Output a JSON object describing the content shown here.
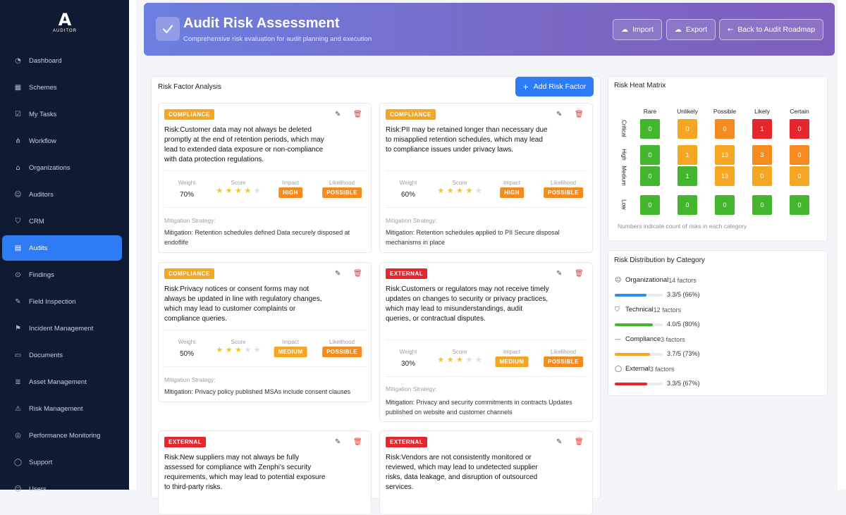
{
  "brand": {
    "mark": "A",
    "name": "AUDITOR"
  },
  "nav": [
    {
      "label": "Dashboard",
      "icon": "dashboard-icon",
      "glyph": "◔"
    },
    {
      "label": "Schemes",
      "icon": "grid-icon",
      "glyph": "▦"
    },
    {
      "label": "My Tasks",
      "icon": "checkbox-icon",
      "glyph": "☑"
    },
    {
      "label": "Workflow",
      "icon": "workflow-icon",
      "glyph": "⋔"
    },
    {
      "label": "Organizations",
      "icon": "bank-icon",
      "glyph": "⌂"
    },
    {
      "label": "Auditors",
      "icon": "users-icon",
      "glyph": "☺"
    },
    {
      "label": "CRM",
      "icon": "shield-icon",
      "glyph": "⛉"
    },
    {
      "label": "Audits",
      "icon": "clipboard-icon",
      "glyph": "▤",
      "active": true
    },
    {
      "label": "Findings",
      "icon": "search-icon",
      "glyph": "⊙"
    },
    {
      "label": "Field Inspection",
      "icon": "edit-icon",
      "glyph": "✎"
    },
    {
      "label": "Incident Management",
      "icon": "incident-icon",
      "glyph": "⚑"
    },
    {
      "label": "Documents",
      "icon": "document-icon",
      "glyph": "▭"
    },
    {
      "label": "Asset Management",
      "icon": "database-icon",
      "glyph": "≣"
    },
    {
      "label": "Risk Management",
      "icon": "warning-icon",
      "glyph": "⚠"
    },
    {
      "label": "Performance Monitoring",
      "icon": "monitor-icon",
      "glyph": "◎"
    },
    {
      "label": "Support",
      "icon": "support-icon",
      "glyph": "◯"
    },
    {
      "label": "Users",
      "icon": "user-icon",
      "glyph": "☺"
    }
  ],
  "header": {
    "title": "Audit Risk Assessment",
    "subtitle": "Comprehensive risk evaluation for audit planning and execution",
    "import_label": "Import",
    "export_label": "Export",
    "back_label": "Back to Audit Roadmap"
  },
  "analysis": {
    "title": "Risk Factor Analysis",
    "add_label": "Add Risk Factor",
    "metric_labels": {
      "weight": "Weight",
      "score": "Score",
      "impact": "Impact",
      "likelihood": "Likelihood"
    },
    "mitigation_label": "Mitigation Strategy:",
    "cards": [
      {
        "category": "COMPLIANCE",
        "category_color": "#f5a623",
        "risk": "Risk:Customer data may not always be deleted promptly at the end of retention periods, which may lead to extended data exposure or non-compliance with data protection regulations.",
        "weight": "70%",
        "stars": 4,
        "impact": "HIGH",
        "impact_color": "#f58a1f",
        "likelihood": "POSSIBLE",
        "likelihood_color": "#f58a1f",
        "mitigation": "Mitigation: Retention schedules defined Data securely disposed at endoflife"
      },
      {
        "category": "COMPLIANCE",
        "category_color": "#f5a623",
        "risk": "Risk:PII may be retained longer than necessary due to misapplied retention schedules, which may lead to compliance issues under privacy laws.",
        "weight": "60%",
        "stars": 4,
        "impact": "HIGH",
        "impact_color": "#f58a1f",
        "likelihood": "POSSIBLE",
        "likelihood_color": "#f58a1f",
        "mitigation": "Mitigation: Retention schedules applied to PII Secure disposal mechanisms in place"
      },
      {
        "category": "COMPLIANCE",
        "category_color": "#f5a623",
        "risk": "Risk:Privacy notices or consent forms may not always be updated in line with regulatory changes, which may lead to customer complaints or compliance queries.",
        "weight": "50%",
        "stars": 3,
        "impact": "MEDIUM",
        "impact_color": "#f5a623",
        "likelihood": "POSSIBLE",
        "likelihood_color": "#f58a1f",
        "mitigation": "Mitigation: Privacy policy published MSAs include consent clauses"
      },
      {
        "category": "EXTERNAL",
        "category_color": "#e5262c",
        "risk": "Risk:Customers or regulators may not receive timely updates on changes to security or privacy practices, which may lead to misunderstandings, audit queries, or contractual disputes.",
        "weight": "30%",
        "stars": 3,
        "impact": "MEDIUM",
        "impact_color": "#f5a623",
        "likelihood": "POSSIBLE",
        "likelihood_color": "#f58a1f",
        "mitigation": "Mitigation: Privacy and security commitments in contracts Updates published on website and customer channels"
      },
      {
        "category": "EXTERNAL",
        "category_color": "#e5262c",
        "risk": "Risk:New suppliers may not always be fully assessed for compliance with Zenphi's security requirements, which may lead to potential exposure to third-party risks."
      },
      {
        "category": "EXTERNAL",
        "category_color": "#e5262c",
        "risk": "Risk:Vendors are not consistently monitored or reviewed, which may lead to undetected supplier risks, data leakage, and disruption of outsourced services."
      }
    ]
  },
  "heatmap": {
    "title": "Risk Heat Matrix",
    "columns": [
      "Rare",
      "Unlikely",
      "Possible",
      "Likely",
      "Certain"
    ],
    "rows": [
      {
        "label": "Critical",
        "cells": [
          {
            "v": "0",
            "c": "#43b62e"
          },
          {
            "v": "0",
            "c": "#f5a623"
          },
          {
            "v": "0",
            "c": "#f58a1f"
          },
          {
            "v": "1",
            "c": "#e5262c"
          },
          {
            "v": "0",
            "c": "#e5262c"
          }
        ]
      },
      {
        "label": "High",
        "cells": [
          {
            "v": "0",
            "c": "#43b62e"
          },
          {
            "v": "1",
            "c": "#f5a623"
          },
          {
            "v": "13",
            "c": "#f5a623"
          },
          {
            "v": "3",
            "c": "#f58a1f"
          },
          {
            "v": "0",
            "c": "#f58a1f"
          }
        ]
      },
      {
        "label": "Medium",
        "cells": [
          {
            "v": "0",
            "c": "#43b62e"
          },
          {
            "v": "1",
            "c": "#43b62e"
          },
          {
            "v": "13",
            "c": "#f5a623"
          },
          {
            "v": "0",
            "c": "#f5a623"
          },
          {
            "v": "0",
            "c": "#f5a623"
          }
        ]
      },
      {
        "label": "Low",
        "cells": [
          {
            "v": "0",
            "c": "#43b62e"
          },
          {
            "v": "0",
            "c": "#43b62e"
          },
          {
            "v": "0",
            "c": "#43b62e"
          },
          {
            "v": "0",
            "c": "#43b62e"
          },
          {
            "v": "0",
            "c": "#43b62e"
          }
        ]
      }
    ],
    "note": "Numbers indicate count of risks in each category"
  },
  "distribution": {
    "title": "Risk Distribution by Category",
    "items": [
      {
        "name": "Organizational",
        "count": "14 factors",
        "icon": "users-icon",
        "glyph": "☺",
        "score": "3.3/5 (66%)",
        "fraction": 0.66,
        "color": "#2d8ef0"
      },
      {
        "name": "Technical",
        "count": "12 factors",
        "icon": "shield-icon",
        "glyph": "⛉",
        "score": "4.0/5 (80%)",
        "fraction": 0.8,
        "color": "#43b62e"
      },
      {
        "name": "Compliance",
        "count": "3 factors",
        "icon": "minus-icon",
        "glyph": "—",
        "score": "3.7/5 (73%)",
        "fraction": 0.73,
        "color": "#f5a623"
      },
      {
        "name": "External",
        "count": "3 factors",
        "icon": "globe-icon",
        "glyph": "◯",
        "score": "3.3/5 (67%)",
        "fraction": 0.67,
        "color": "#e5262c"
      }
    ]
  }
}
